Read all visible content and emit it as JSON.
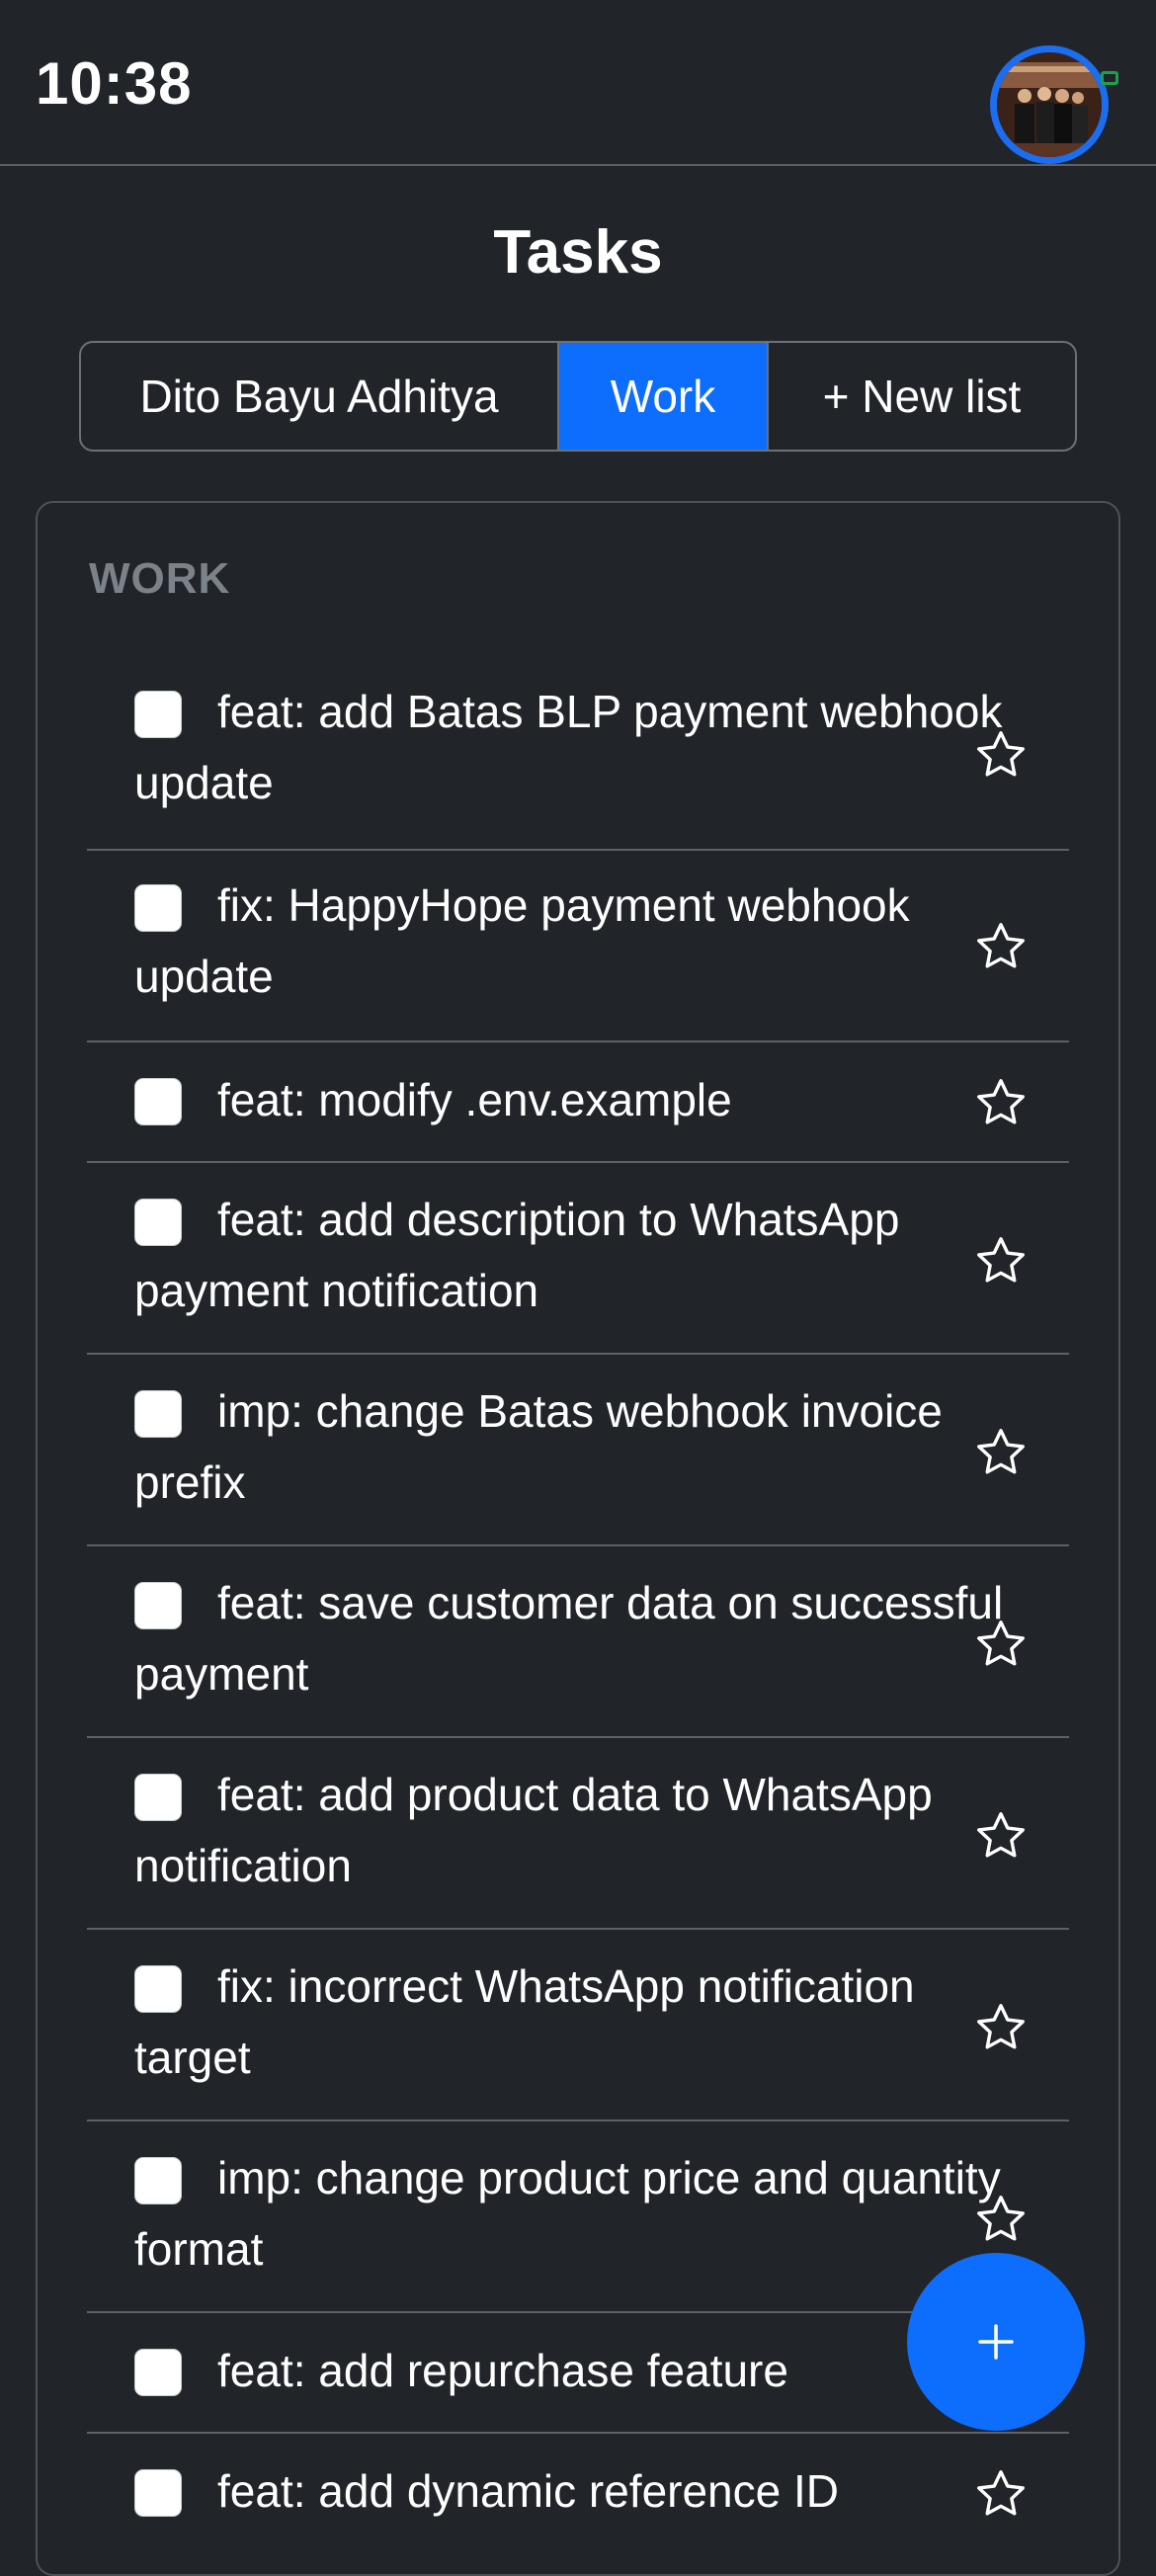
{
  "status_bar": {
    "time": "10:38"
  },
  "page_title": "Tasks",
  "tabs": [
    {
      "label": "Dito Bayu Adhitya",
      "active": false
    },
    {
      "label": "Work",
      "active": true
    },
    {
      "label": "+ New list",
      "active": false
    }
  ],
  "list": {
    "section_label": "WORK",
    "tasks": [
      {
        "text": "feat: add Batas BLP payment webhook update",
        "done": false,
        "starred": false
      },
      {
        "text": "fix: HappyHope payment webhook update",
        "done": false,
        "starred": false
      },
      {
        "text": "feat: modify .env.example",
        "done": false,
        "starred": false
      },
      {
        "text": "feat: add description to WhatsApp payment notification",
        "done": false,
        "starred": false
      },
      {
        "text": "imp: change Batas webhook invoice prefix",
        "done": false,
        "starred": false
      },
      {
        "text": "feat: save customer data on successful payment",
        "done": false,
        "starred": false
      },
      {
        "text": "feat: add product data to WhatsApp notification",
        "done": false,
        "starred": false
      },
      {
        "text": "fix: incorrect WhatsApp notification target",
        "done": false,
        "starred": false
      },
      {
        "text": "imp: change product price and quantity format",
        "done": false,
        "starred": false
      },
      {
        "text": "feat: add repurchase feature",
        "done": false,
        "starred": false
      },
      {
        "text": "feat: add dynamic reference ID",
        "done": false,
        "starred": false
      }
    ]
  },
  "fab": {
    "icon": "plus-icon",
    "color": "#0d6efd"
  },
  "colors": {
    "background": "#212429",
    "accent": "#0d6efd",
    "muted": "#7c828a"
  }
}
